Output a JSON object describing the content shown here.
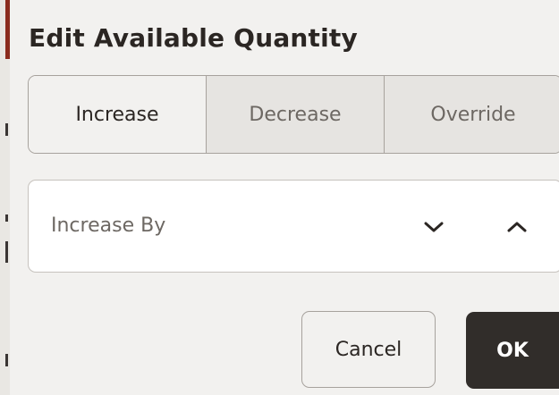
{
  "dialog": {
    "title": "Edit Available Quantity",
    "modes": [
      {
        "label": "Increase",
        "selected": true
      },
      {
        "label": "Decrease",
        "selected": false
      },
      {
        "label": "Override",
        "selected": false
      }
    ],
    "quantity_field": {
      "placeholder": "Increase By",
      "value": "",
      "decrement_icon": "chevron-down-icon",
      "increment_icon": "chevron-up-icon"
    },
    "actions": {
      "cancel_label": "Cancel",
      "ok_label": "OK"
    }
  },
  "colors": {
    "title_text": "#2b2623",
    "muted_text": "#6d6863",
    "selected_segment_bg": "#f2f1ef",
    "unselected_segment_bg": "#e6e4e1",
    "primary_button_bg": "#312d2a",
    "primary_button_text": "#ffffff",
    "border": "#a7a29d"
  }
}
